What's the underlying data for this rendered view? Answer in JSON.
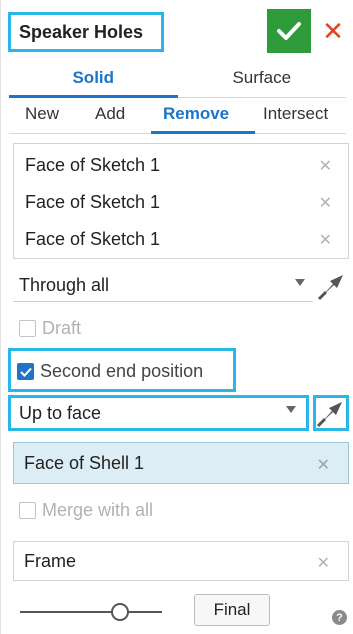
{
  "header": {
    "title": "Speaker Holes",
    "accent_color": "#29b6e8",
    "ok_color": "#2e9b3a",
    "cancel_color": "#e5421d",
    "cancel_glyph": "✕"
  },
  "type_tabs": [
    {
      "label": "Solid",
      "active": true
    },
    {
      "label": "Surface",
      "active": false
    }
  ],
  "operation_tabs": [
    {
      "label": "New",
      "active": false
    },
    {
      "label": "Add",
      "active": false
    },
    {
      "label": "Remove",
      "active": true
    },
    {
      "label": "Intersect",
      "active": false
    }
  ],
  "faces": [
    {
      "label": "Face of Sketch 1"
    },
    {
      "label": "Face of Sketch 1"
    },
    {
      "label": "Face of Sketch 1"
    }
  ],
  "remove_glyph": "✕",
  "end_type": {
    "value": "Through all"
  },
  "draft": {
    "label": "Draft",
    "checked": false
  },
  "second_end": {
    "label": "Second end position",
    "checked": true
  },
  "second_end_type": {
    "value": "Up to face"
  },
  "second_face": {
    "label": "Face of Shell 1"
  },
  "merge": {
    "label": "Merge with all",
    "checked": false
  },
  "frame": {
    "label": "Frame"
  },
  "final_button": {
    "label": "Final"
  },
  "help": {
    "glyph": "?"
  }
}
